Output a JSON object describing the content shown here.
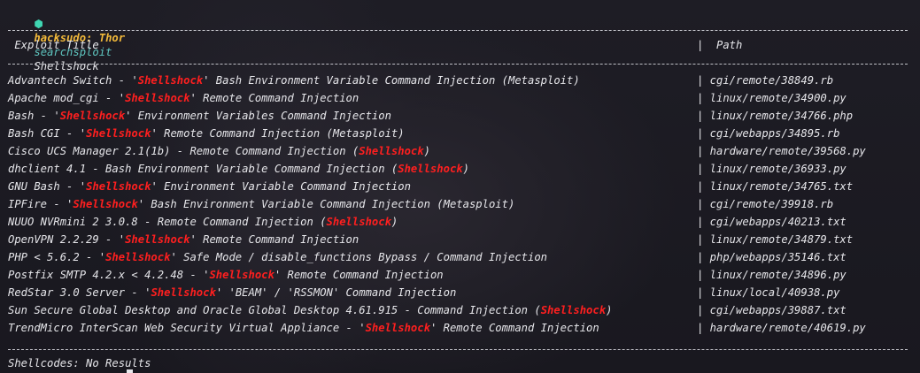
{
  "prompt": {
    "icon": "hexagon-icon",
    "user_host": "hacksudo: Thor",
    "command": "searchsploit",
    "argument": "Shellshock"
  },
  "header": {
    "title": " Exploit Title",
    "path": "|  Path"
  },
  "keyword": "Shellshock",
  "rows": [
    {
      "pre": "Advantech Switch - '",
      "hl": "Shellshock",
      "post": "' Bash Environment Variable Command Injection (Metasploit)",
      "path": "| cgi/remote/38849.rb"
    },
    {
      "pre": "Apache mod_cgi - '",
      "hl": "Shellshock",
      "post": "' Remote Command Injection",
      "path": "| linux/remote/34900.py"
    },
    {
      "pre": "Bash - '",
      "hl": "Shellshock",
      "post": "' Environment Variables Command Injection",
      "path": "| linux/remote/34766.php"
    },
    {
      "pre": "Bash CGI - '",
      "hl": "Shellshock",
      "post": "' Remote Command Injection (Metasploit)",
      "path": "| cgi/webapps/34895.rb"
    },
    {
      "pre": "Cisco UCS Manager 2.1(1b) - Remote Command Injection (",
      "hl": "Shellshock",
      "post": ")",
      "path": "| hardware/remote/39568.py"
    },
    {
      "pre": "dhclient 4.1 - Bash Environment Variable Command Injection (",
      "hl": "Shellshock",
      "post": ")",
      "path": "| linux/remote/36933.py"
    },
    {
      "pre": "GNU Bash - '",
      "hl": "Shellshock",
      "post": "' Environment Variable Command Injection",
      "path": "| linux/remote/34765.txt"
    },
    {
      "pre": "IPFire - '",
      "hl": "Shellshock",
      "post": "' Bash Environment Variable Command Injection (Metasploit)",
      "path": "| cgi/remote/39918.rb"
    },
    {
      "pre": "NUUO NVRmini 2 3.0.8 - Remote Command Injection (",
      "hl": "Shellshock",
      "post": ")",
      "path": "| cgi/webapps/40213.txt"
    },
    {
      "pre": "OpenVPN 2.2.29 - '",
      "hl": "Shellshock",
      "post": "' Remote Command Injection",
      "path": "| linux/remote/34879.txt"
    },
    {
      "pre": "PHP < 5.6.2 - '",
      "hl": "Shellshock",
      "post": "' Safe Mode / disable_functions Bypass / Command Injection",
      "path": "| php/webapps/35146.txt"
    },
    {
      "pre": "Postfix SMTP 4.2.x < 4.2.48 - '",
      "hl": "Shellshock",
      "post": "' Remote Command Injection",
      "path": "| linux/remote/34896.py"
    },
    {
      "pre": "RedStar 3.0 Server - '",
      "hl": "Shellshock",
      "post": "' 'BEAM' / 'RSSMON' Command Injection",
      "path": "| linux/local/40938.py"
    },
    {
      "pre": "Sun Secure Global Desktop and Oracle Global Desktop 4.61.915 - Command Injection (",
      "hl": "Shellshock",
      "post": ")",
      "path": "| cgi/webapps/39887.txt"
    },
    {
      "pre": "TrendMicro InterScan Web Security Virtual Appliance - '",
      "hl": "Shellshock",
      "post": "' Remote Command Injection",
      "path": "| hardware/remote/40619.py"
    }
  ],
  "footer": "Shellcodes: No Results",
  "colors": {
    "background": "#1b1a22",
    "text": "#e6e6ea",
    "highlight": "#ff1f1f",
    "user": "#f2b93a",
    "command": "#5fc6c0",
    "prompt_icon": "#3fd6b2"
  }
}
